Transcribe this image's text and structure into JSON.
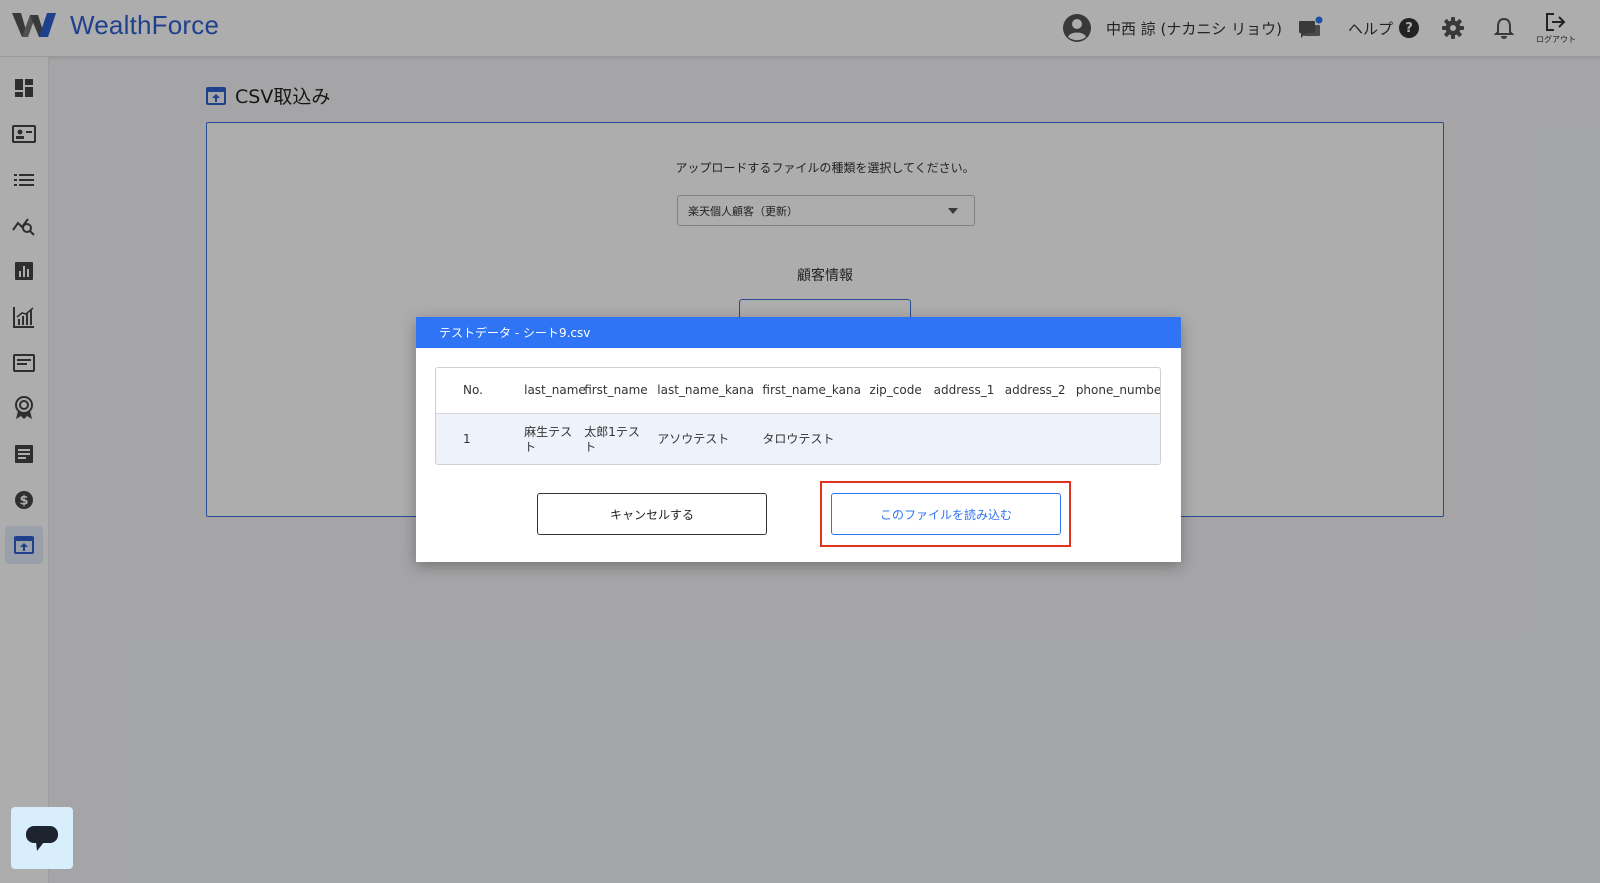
{
  "app": {
    "logo_text": "WealthForce"
  },
  "header": {
    "user_name": "中西 諒 (ナカニシ リョウ)",
    "help_label": "ヘルプ",
    "help_symbol": "?",
    "logout_label": "ログアウト"
  },
  "sidebar": {
    "items": [
      {
        "icon": "dashboard-icon"
      },
      {
        "icon": "customer-card-icon"
      },
      {
        "icon": "list-icon"
      },
      {
        "icon": "analysis-search-icon"
      },
      {
        "icon": "bar-chart-icon"
      },
      {
        "icon": "growth-chart-icon"
      },
      {
        "icon": "message-board-icon"
      },
      {
        "icon": "award-icon"
      },
      {
        "icon": "document-icon"
      },
      {
        "icon": "dollar-icon"
      },
      {
        "icon": "upload-icon",
        "active": true
      }
    ]
  },
  "page": {
    "title": "CSV取込み",
    "instruction": "アップロードするファイルの種類を選択してください。",
    "file_type_selected": "楽天個人顧客（更新）",
    "section_label": "顧客情報"
  },
  "modal": {
    "title": "テストデータ - シート9.csv",
    "columns": [
      "No.",
      "last_name",
      "first_name",
      "last_name_kana",
      "first_name_kana",
      "zip_code",
      "address_1",
      "address_2",
      "phone_number"
    ],
    "rows": [
      [
        "1",
        "麻生テスト",
        "太郎1テスト",
        "アソウテスト",
        "タロウテスト",
        "",
        "",
        "",
        ""
      ]
    ],
    "cancel_label": "キャンセルする",
    "load_label": "このファイルを読み込む"
  },
  "colors": {
    "accent": "#2f74f5",
    "brand": "#2f5fd0",
    "highlight": "#e0321c"
  }
}
